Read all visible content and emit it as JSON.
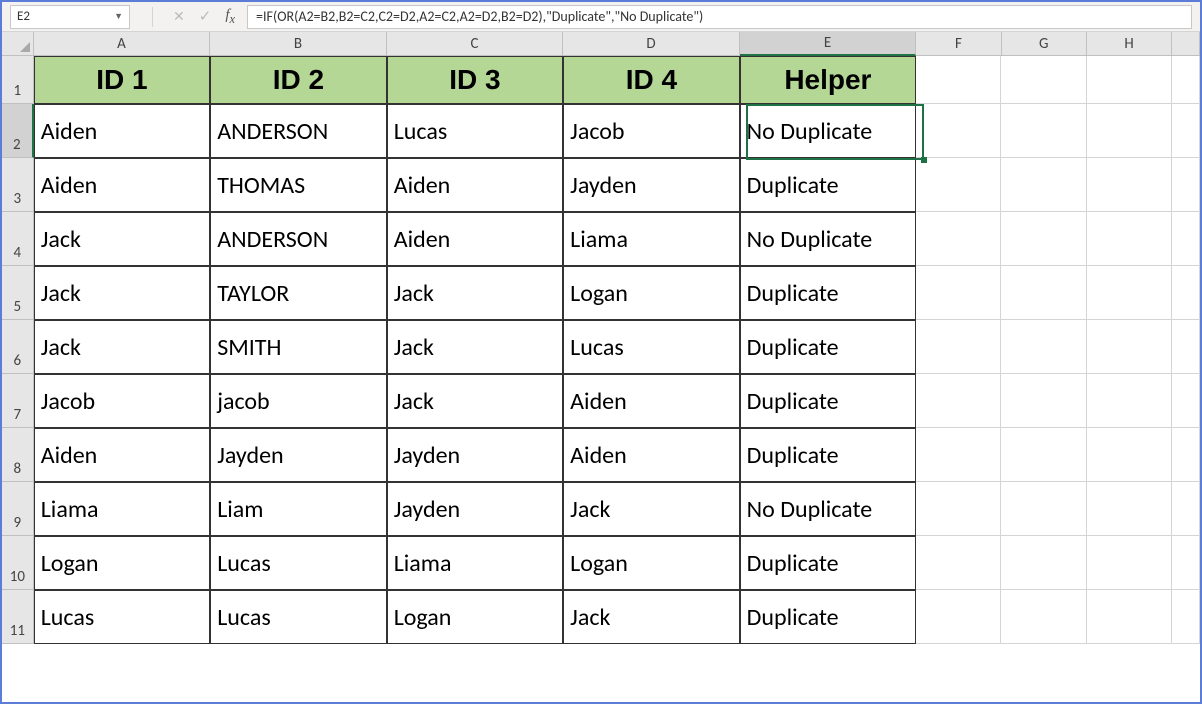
{
  "name_box": "E2",
  "formula": "=IF(OR(A2=B2,B2=C2,C2=D2,A2=C2,A2=D2,B2=D2),\"Duplicate\",\"No Duplicate\")",
  "columns": [
    "A",
    "B",
    "C",
    "D",
    "E",
    "F",
    "G",
    "H"
  ],
  "selected_col": "E",
  "selected_row": "2",
  "row_numbers": [
    "1",
    "2",
    "3",
    "4",
    "5",
    "6",
    "7",
    "8",
    "9",
    "10",
    "11"
  ],
  "headers": {
    "A": "ID 1",
    "B": "ID 2",
    "C": "ID 3",
    "D": "ID 4",
    "E": "Helper"
  },
  "rows": [
    {
      "A": "Aiden",
      "B": "ANDERSON",
      "C": "Lucas",
      "D": "Jacob",
      "E": "No Duplicate"
    },
    {
      "A": "Aiden",
      "B": "THOMAS",
      "C": "Aiden",
      "D": "Jayden",
      "E": "Duplicate"
    },
    {
      "A": "Jack",
      "B": "ANDERSON",
      "C": "Aiden",
      "D": "Liama",
      "E": "No Duplicate"
    },
    {
      "A": "Jack",
      "B": "TAYLOR",
      "C": "Jack",
      "D": "Logan",
      "E": "Duplicate"
    },
    {
      "A": "Jack",
      "B": "SMITH",
      "C": "Jack",
      "D": "Lucas",
      "E": "Duplicate"
    },
    {
      "A": "Jacob",
      "B": "jacob",
      "C": "Jack",
      "D": "Aiden",
      "E": "Duplicate"
    },
    {
      "A": "Aiden",
      "B": "Jayden",
      "C": "Jayden",
      "D": "Aiden",
      "E": "Duplicate"
    },
    {
      "A": "Liama",
      "B": "Liam",
      "C": "Jayden",
      "D": "Jack",
      "E": "No Duplicate"
    },
    {
      "A": "Logan",
      "B": "Lucas",
      "C": "Liama",
      "D": "Logan",
      "E": "Duplicate"
    },
    {
      "A": "Lucas",
      "B": "Lucas",
      "C": "Logan",
      "D": "Jack",
      "E": "Duplicate"
    }
  ]
}
